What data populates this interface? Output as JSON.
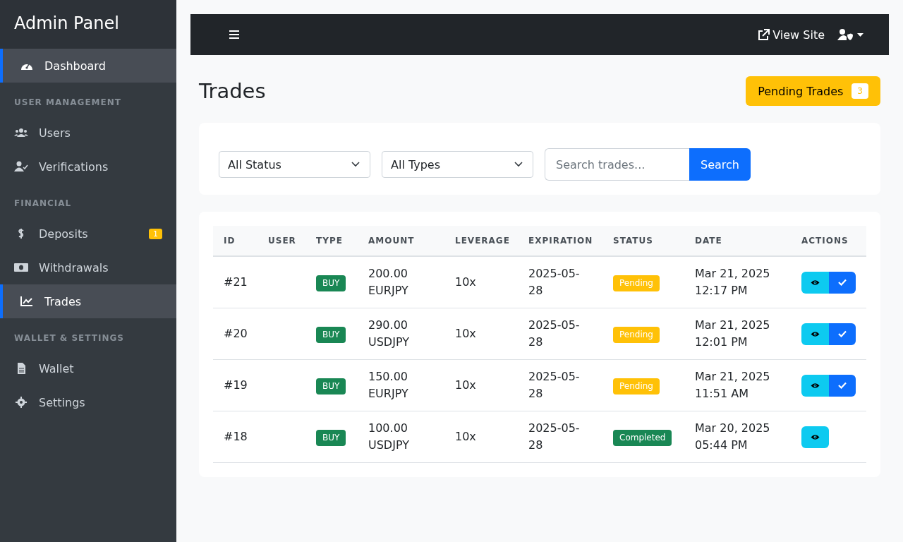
{
  "sidebar": {
    "title": "Admin Panel",
    "sections": [
      {
        "items": [
          {
            "label": "Dashboard",
            "selected": true
          }
        ]
      },
      {
        "heading": "USER MANAGEMENT",
        "items": [
          {
            "label": "Users",
            "selected": false
          },
          {
            "label": "Verifications",
            "selected": false
          }
        ]
      },
      {
        "heading": "FINANCIAL",
        "items": [
          {
            "label": "Deposits",
            "selected": false,
            "badge": "1"
          },
          {
            "label": "Withdrawals",
            "selected": false
          },
          {
            "label": "Trades",
            "selected": true
          }
        ]
      },
      {
        "heading": "WALLET & SETTINGS",
        "items": [
          {
            "label": "Wallet",
            "selected": false
          },
          {
            "label": "Settings",
            "selected": false
          }
        ]
      }
    ]
  },
  "navbar": {
    "view_site": "View Site"
  },
  "page": {
    "title": "Trades",
    "pending_button": {
      "label": "Pending Trades",
      "count": "3"
    }
  },
  "filters": {
    "status": "All Status",
    "type": "All Types",
    "search": {
      "placeholder": "Search trades..."
    },
    "search_button": "Search"
  },
  "table": {
    "columns": [
      "ID",
      "USER",
      "TYPE",
      "AMOUNT",
      "LEVERAGE",
      "EXPIRATION",
      "STATUS",
      "DATE",
      "ACTIONS"
    ],
    "rows": [
      {
        "id": "#21",
        "type": "BUY",
        "amount": "200.00 EURJPY",
        "leverage": "10x",
        "expiration": "2025-05-28",
        "status": {
          "label": "Pending",
          "kind": "pending"
        },
        "date": "Mar 21, 2025 12:17 PM",
        "approvable": true
      },
      {
        "id": "#20",
        "type": "BUY",
        "amount": "290.00 USDJPY",
        "leverage": "10x",
        "expiration": "2025-05-28",
        "status": {
          "label": "Pending",
          "kind": "pending"
        },
        "date": "Mar 21, 2025 12:01 PM",
        "approvable": true
      },
      {
        "id": "#19",
        "type": "BUY",
        "amount": "150.00 EURJPY",
        "leverage": "10x",
        "expiration": "2025-05-28",
        "status": {
          "label": "Pending",
          "kind": "pending"
        },
        "date": "Mar 21, 2025 11:51 AM",
        "approvable": true
      },
      {
        "id": "#18",
        "type": "BUY",
        "amount": "100.00 USDJPY",
        "leverage": "10x",
        "expiration": "2025-05-28",
        "status": {
          "label": "Completed",
          "kind": "completed"
        },
        "date": "Mar 20, 2025 05:44 PM",
        "approvable": false
      }
    ]
  }
}
